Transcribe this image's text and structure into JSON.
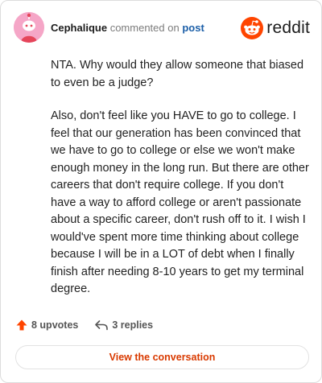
{
  "comment": {
    "author": "Cephalique",
    "verb": "commented on",
    "link_text": "post",
    "paragraphs": [
      "NTA. Why would they allow someone that biased to even be a judge?",
      "Also, don't feel like you HAVE to go to college. I feel that our generation has been convinced that we have to go to college or else we won't make enough money in the long run. But there are other careers that don't require college. If you don't have a way to afford college or aren't passionate about a specific career, don't rush off to it. I wish I would've spent more time thinking about college because I will be in a LOT of debt when I finally finish after needing 8-10 years to get my terminal degree."
    ]
  },
  "brand": {
    "name": "reddit",
    "icon": "reddit-logo-icon",
    "color": "#ff4500"
  },
  "stats": {
    "upvotes": "8 upvotes",
    "upvote_icon": "upvote-arrow-icon",
    "replies": "3 replies",
    "reply_icon": "reply-icon"
  },
  "cta": {
    "label": "View the conversation",
    "color": "#d93a00"
  }
}
